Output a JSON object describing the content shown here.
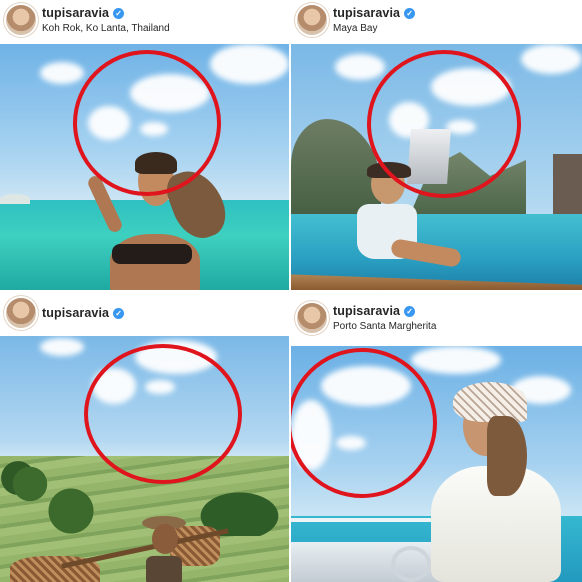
{
  "posts": [
    {
      "username": "tupisaravia",
      "location": "Koh Rok, Ko Lanta, Thailand"
    },
    {
      "username": "tupisaravia",
      "location": "Maya Bay"
    },
    {
      "username": "tupisaravia",
      "location": ""
    },
    {
      "username": "tupisaravia",
      "location": "Porto Santa Margherita"
    }
  ],
  "icons": {
    "verified": "verified-badge-icon",
    "avatar": "profile-avatar"
  },
  "colors": {
    "highlight_circle": "#e0141c",
    "verified": "#3897f0",
    "sky": "#8cc3ea",
    "sea": "#3ec9c0"
  }
}
